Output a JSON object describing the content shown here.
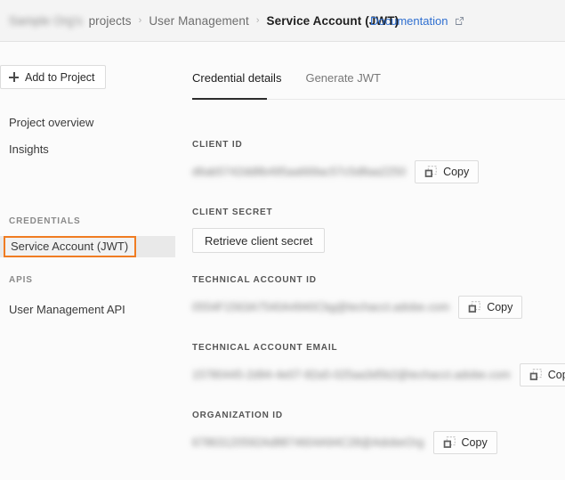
{
  "header": {
    "breadcrumb": [
      {
        "label": "Sample Org's",
        "state": "blurred"
      },
      {
        "label": "projects",
        "state": "link"
      },
      {
        "label": "User Management",
        "state": "link"
      },
      {
        "label": "Service Account (JWT)",
        "state": "current"
      }
    ],
    "separator": "›",
    "documentation_label": "Documentation",
    "documentation_icon": "external-link-icon"
  },
  "sidebar": {
    "add_to_project_label": "Add to Project",
    "add_icon": "plus-icon",
    "items": [
      {
        "label": "Project overview",
        "type": "nav"
      },
      {
        "label": "Insights",
        "type": "nav"
      }
    ],
    "sections": [
      {
        "label": "CREDENTIALS",
        "items": [
          {
            "label": "Service Account (JWT)",
            "selected": true,
            "annotated": true
          }
        ]
      },
      {
        "label": "APIS",
        "items": [
          {
            "label": "User Management API",
            "selected": false
          }
        ]
      }
    ]
  },
  "main": {
    "tabs": [
      {
        "label": "Credential details",
        "active": true
      },
      {
        "label": "Generate JWT",
        "active": false
      }
    ],
    "fields": [
      {
        "label": "CLIENT ID",
        "value": "d6ab5742dd8b495aa669ac57c5d8aa2250",
        "value_blurred": true,
        "action": {
          "label": "Copy",
          "icon": "copy-icon"
        }
      },
      {
        "label": "CLIENT SECRET",
        "value": "",
        "value_blurred": false,
        "action": {
          "label": "Retrieve client secret",
          "icon": "none"
        }
      },
      {
        "label": "TECHNICAL ACCOUNT ID",
        "value": "0554F1563A7540A4940Cbg@techacct.adobe.com",
        "value_blurred": true,
        "action": {
          "label": "Copy",
          "icon": "copy-icon"
        }
      },
      {
        "label": "TECHNICAL ACCOUNT EMAIL",
        "value": "15780445-2d94-4e07-82a5-025aa3d5b2@techacct.adobe.com",
        "value_blurred": true,
        "action": {
          "label": "Copy",
          "icon": "copy-icon"
        }
      },
      {
        "label": "ORGANIZATION ID",
        "value": "67863120592Ad8874604A94C28@AdobeOrg",
        "value_blurred": true,
        "action": {
          "label": "Copy",
          "icon": "copy-icon"
        }
      }
    ]
  },
  "colors": {
    "link_blue": "#2f6fd0",
    "annotation_orange": "#f07c22",
    "selected_gray": "#e9e9e9",
    "active_tab_underline": "#2c2c2c",
    "page_background": "#fbfbfb",
    "header_background": "#f4f4f4",
    "border": "#e2e2e2"
  }
}
